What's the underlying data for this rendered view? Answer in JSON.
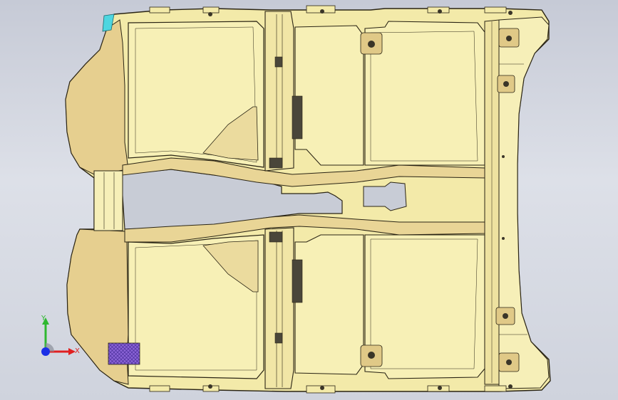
{
  "viewport": {
    "background_top": "#c6cad6",
    "background_bottom": "#cfd3dd"
  },
  "model": {
    "description_icon": "floor-panel-part",
    "body_color": "#f5eeab",
    "shade_color": "#e3cf8e",
    "edge_color": "#2a2414",
    "highlight_color": "#4ed6e0",
    "mesh_color": "#7a55c8"
  },
  "triad": {
    "x_label": "X",
    "y_label": "Y",
    "x_color": "#e02020",
    "y_color": "#2fb830",
    "z_color": "#1b2fe6"
  }
}
